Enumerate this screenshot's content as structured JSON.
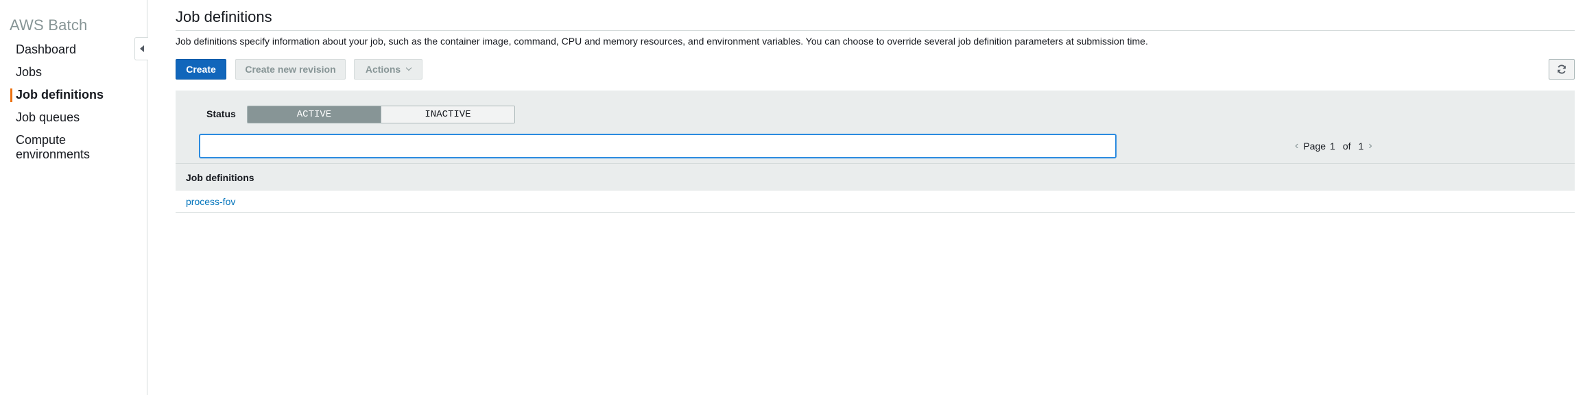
{
  "sidebar": {
    "title": "AWS Batch",
    "items": [
      {
        "label": "Dashboard"
      },
      {
        "label": "Jobs"
      },
      {
        "label": "Job definitions"
      },
      {
        "label": "Job queues"
      },
      {
        "label": "Compute\nenvironments"
      }
    ],
    "active_index": 2
  },
  "page": {
    "title": "Job definitions",
    "description": "Job definitions specify information about your job, such as the container image, command, CPU and memory resources, and environment variables. You can choose to override several job definition parameters at submission time."
  },
  "toolbar": {
    "create_label": "Create",
    "new_revision_label": "Create new revision",
    "actions_label": "Actions",
    "refresh_icon": "refresh-icon"
  },
  "filter": {
    "status_label": "Status",
    "options": [
      "ACTIVE",
      "INACTIVE"
    ],
    "selected": "ACTIVE",
    "search_value": "",
    "search_placeholder": ""
  },
  "pagination": {
    "prefix": "Page",
    "current": "1",
    "of": "of",
    "total": "1"
  },
  "table": {
    "columns": [
      "Job definitions"
    ],
    "rows": [
      {
        "name": "process-fov"
      }
    ]
  },
  "colors": {
    "accent_orange": "#ec7211",
    "primary_blue": "#1166bb",
    "link_blue": "#0073bb",
    "focus_blue": "#2b8be0"
  }
}
